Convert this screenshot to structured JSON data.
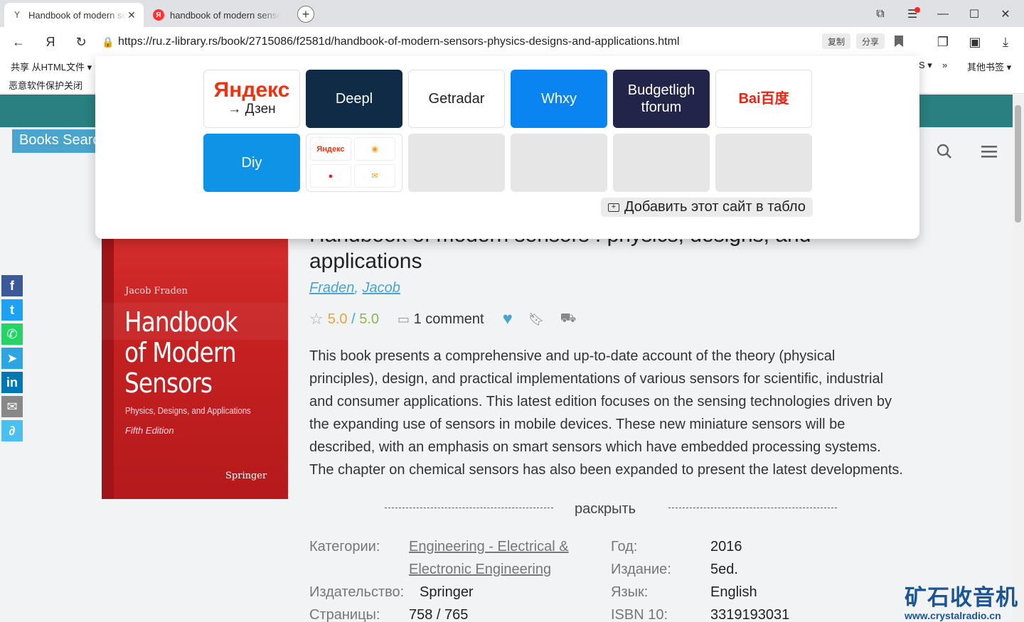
{
  "tabs": [
    {
      "title": "Handbook of modern sensors",
      "active": true
    },
    {
      "title": "handbook of modern sensors",
      "active": false
    }
  ],
  "toolbar": {
    "url": "https://ru.z-library.rs/book/2715086/f2581d/handbook-of-modern-sensors-physics-designs-and-applications.html",
    "copy_label": "复制",
    "share_label": "分享"
  },
  "bookmarks": {
    "share_html": "共享 从HTML文件 ▾",
    "more": "S ▾",
    "chevrons": "»",
    "other": "其他书签 ▾"
  },
  "infobar": {
    "text": "恶意软件保护关闭"
  },
  "tableau": {
    "tiles_row1": [
      {
        "kind": "yandex",
        "logo": "Яндекс",
        "sub": "→ Дзен"
      },
      {
        "kind": "text",
        "label": "Deepl",
        "bg": "#0f2b46",
        "fg": "#ffffff"
      },
      {
        "kind": "text",
        "label": "Getradar",
        "bg": "#ffffff",
        "fg": "#222222"
      },
      {
        "kind": "text",
        "label": "Whxy",
        "bg": "#0a84f0",
        "fg": "#ffffff"
      },
      {
        "kind": "text",
        "label": "Budgetligh tforum",
        "bg": "#232449",
        "fg": "#ffffff"
      },
      {
        "kind": "baidu",
        "label": "Bai百度"
      }
    ],
    "tiles_row2": [
      {
        "kind": "text",
        "label": "Diy",
        "bg": "#0f93e6",
        "fg": "#ffffff"
      },
      {
        "kind": "folder",
        "mini": [
          "Яндекс",
          "◉",
          "●",
          "✉"
        ]
      },
      {
        "kind": "empty"
      },
      {
        "kind": "empty"
      },
      {
        "kind": "empty"
      },
      {
        "kind": "empty"
      }
    ],
    "add_site_label": "Добавить этот сайт в табло"
  },
  "page": {
    "search_tab": "Books Search",
    "book": {
      "title": "Handbook of modern sensors : physics, designs, and applications",
      "title_visible_line2": "applications",
      "author_1": "Fraden",
      "author_2": "Jacob",
      "rating": "5.0",
      "rating_max": "5.0",
      "comments": "1 comment",
      "description": "This book presents a comprehensive and up-to-date account of the theory (physical principles), design, and practical implementations of various sensors for scientific, industrial and consumer applications. This latest edition focuses on the sensing technologies driven by the expanding use of sensors in mobile devices. These new miniature sensors will be described, with an emphasis on smart sensors which have embedded processing systems. The chapter on chemical sensors has also been expanded to present the latest developments.",
      "expand_label": "раскрыть"
    },
    "cover": {
      "author": "Jacob Fraden",
      "title_lines": [
        "Handbook",
        "of Modern",
        "Sensors"
      ],
      "subtitle": "Physics, Designs, and Applications",
      "edition": "Fifth Edition",
      "publisher": "Springer"
    },
    "properties": {
      "categories_label": "Категории:",
      "categories_value_1": "Engineering - Electrical &",
      "categories_value_2": "Electronic Engineering",
      "publisher_label": "Издательство:",
      "publisher_value": "Springer",
      "pages_label": "Страницы:",
      "pages_value": "758 / 765",
      "year_label": "Год:",
      "year_value": "2016",
      "edition_label": "Издание:",
      "edition_value": "5ed.",
      "language_label": "Язык:",
      "language_value": "English",
      "isbn_label": "ISBN 10:",
      "isbn_value": "3319193031"
    },
    "share_buttons": [
      {
        "name": "facebook",
        "glyph": "f",
        "color": "#3b5998"
      },
      {
        "name": "twitter",
        "glyph": "t",
        "color": "#1da1f2"
      },
      {
        "name": "whatsapp",
        "glyph": "✆",
        "color": "#25d366"
      },
      {
        "name": "telegram",
        "glyph": "➤",
        "color": "#2ca5e0"
      },
      {
        "name": "linkedin",
        "glyph": "in",
        "color": "#0077b5"
      },
      {
        "name": "email",
        "glyph": "✉",
        "color": "#888888"
      },
      {
        "name": "link",
        "glyph": "∂",
        "color": "#49c0ef"
      }
    ]
  },
  "watermark": {
    "cn": "矿石收音机",
    "site": "www.crystalradio.cn"
  }
}
